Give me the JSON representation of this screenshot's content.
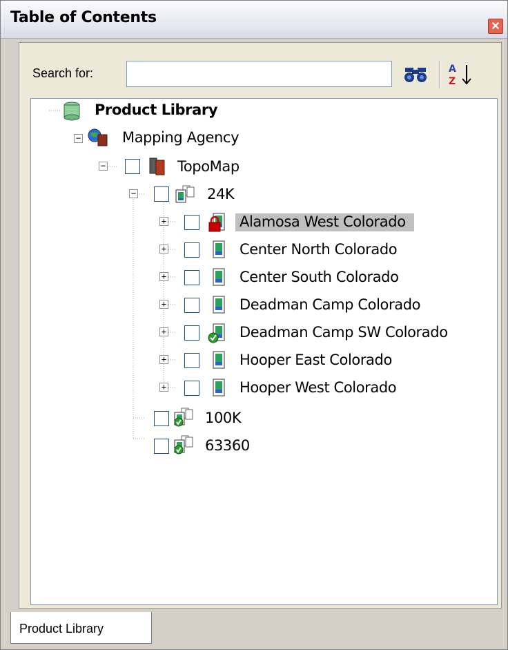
{
  "window": {
    "title": "Table of Contents"
  },
  "search": {
    "label": "Search for:",
    "value": "",
    "placeholder": ""
  },
  "tree": {
    "root": "Product Library",
    "agency": "Mapping Agency",
    "product": "TopoMap",
    "scales": [
      "24K",
      "100K",
      "63360"
    ],
    "sheets": [
      "Alamosa West Colorado",
      "Center North Colorado",
      "Center South Colorado",
      "Deadman Camp Colorado",
      "Deadman Camp SW Colorado",
      "Hooper East Colorado",
      "Hooper West Colorado"
    ],
    "selected_sheet": "Alamosa West Colorado",
    "sheet_status": [
      "locked",
      "none",
      "none",
      "none",
      "checked-out",
      "none",
      "none"
    ]
  },
  "tabs": [
    {
      "label": "Product Library",
      "active": true
    }
  ],
  "colors": {
    "accent_close": "#e4644f",
    "lock": "#cc0000",
    "check": "#2e9e2e",
    "selection": "#c0c0c0"
  },
  "icons": {
    "close": "close-icon",
    "find": "binoculars-icon",
    "sort": "sort-az-icon",
    "root": "database-icon",
    "agency": "globe-book-icon",
    "product": "books-icon",
    "scale": "map-series-icon",
    "sheet": "map-sheet-icon"
  }
}
